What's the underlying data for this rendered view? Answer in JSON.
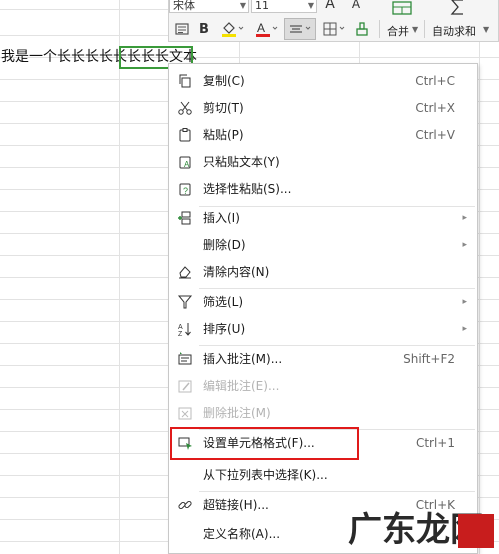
{
  "sheet": {
    "cell_text_before": "我是一个长长长长",
    "cell_text_selected": "长长长长文",
    "cell_text_after": "本"
  },
  "toolbar": {
    "font_name": "宋体",
    "font_size": "11",
    "font_grow_label": "A",
    "font_shrink_label": "A",
    "bold_label": "B",
    "font_color_label": "A",
    "merge_label": "合并",
    "autosum_label": "自动求和",
    "accent_font": "#e02020",
    "accent_fill": "#f5e100",
    "accent_green": "#2f8a3a"
  },
  "menu": {
    "items": [
      {
        "icon": "copy-icon",
        "label": "复制(C)",
        "shortcut": "Ctrl+C"
      },
      {
        "icon": "cut-icon",
        "label": "剪切(T)",
        "shortcut": "Ctrl+X"
      },
      {
        "icon": "paste-icon",
        "label": "粘贴(P)",
        "shortcut": "Ctrl+V"
      },
      {
        "icon": "paste-text-icon",
        "label": "只粘贴文本(Y)",
        "shortcut": ""
      },
      {
        "icon": "paste-special-icon",
        "label": "选择性粘贴(S)...",
        "shortcut": ""
      },
      {
        "icon": "insert-icon",
        "label": "插入(I)",
        "shortcut": ""
      },
      {
        "icon": "",
        "label": "删除(D)",
        "shortcut": ""
      },
      {
        "icon": "clear-icon",
        "label": "清除内容(N)",
        "shortcut": ""
      },
      {
        "icon": "filter-icon",
        "label": "筛选(L)",
        "shortcut": ""
      },
      {
        "icon": "sort-icon",
        "label": "排序(U)",
        "shortcut": ""
      },
      {
        "icon": "insert-comment-icon",
        "label": "插入批注(M)...",
        "shortcut": "Shift+F2"
      },
      {
        "icon": "edit-comment-icon",
        "label": "编辑批注(E)...",
        "shortcut": ""
      },
      {
        "icon": "delete-comment-icon",
        "label": "删除批注(M)",
        "shortcut": ""
      },
      {
        "icon": "format-cells-icon",
        "label": "设置单元格格式(F)...",
        "shortcut": "Ctrl+1"
      },
      {
        "icon": "",
        "label": "从下拉列表中选择(K)...",
        "shortcut": ""
      },
      {
        "icon": "hyperlink-icon",
        "label": "超链接(H)...",
        "shortcut": "Ctrl+K"
      },
      {
        "icon": "",
        "label": "定义名称(A)...",
        "shortcut": ""
      }
    ],
    "submenu_arrow": "▸"
  },
  "watermark": {
    "text": "广东龙网",
    "brand_color": "#c81d1d"
  }
}
